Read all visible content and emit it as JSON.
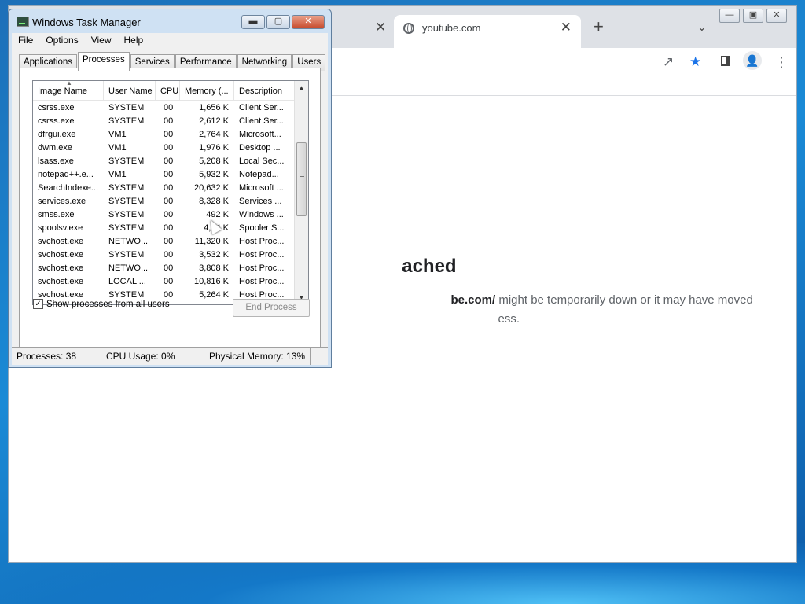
{
  "browser": {
    "active_tab_title": "youtube.com",
    "new_tab_symbol": "+",
    "close_symbol": "✕",
    "error": {
      "title_partial": "ached",
      "url_partial": "be.com/",
      "line1_rest": " might be temporarily down or it may have moved",
      "line2_partial": "ess."
    }
  },
  "task_manager": {
    "title": "Windows Task Manager",
    "menu": [
      "File",
      "Options",
      "View",
      "Help"
    ],
    "tabs": [
      "Applications",
      "Processes",
      "Services",
      "Performance",
      "Networking",
      "Users"
    ],
    "active_tab": "Processes",
    "columns": {
      "name": "Image Name",
      "user": "User Name",
      "cpu": "CPU",
      "memory": "Memory (...",
      "description": "Description"
    },
    "processes": [
      {
        "name": "csrss.exe",
        "user": "SYSTEM",
        "cpu": "00",
        "memory": "1,656 K",
        "description": "Client Ser..."
      },
      {
        "name": "csrss.exe",
        "user": "SYSTEM",
        "cpu": "00",
        "memory": "2,612 K",
        "description": "Client Ser..."
      },
      {
        "name": "dfrgui.exe",
        "user": "VM1",
        "cpu": "00",
        "memory": "2,764 K",
        "description": "Microsoft..."
      },
      {
        "name": "dwm.exe",
        "user": "VM1",
        "cpu": "00",
        "memory": "1,976 K",
        "description": "Desktop ..."
      },
      {
        "name": "lsass.exe",
        "user": "SYSTEM",
        "cpu": "00",
        "memory": "5,208 K",
        "description": "Local Sec..."
      },
      {
        "name": "notepad++.e...",
        "user": "VM1",
        "cpu": "00",
        "memory": "5,932 K",
        "description": "Notepad..."
      },
      {
        "name": "SearchIndexe...",
        "user": "SYSTEM",
        "cpu": "00",
        "memory": "20,632 K",
        "description": "Microsoft ..."
      },
      {
        "name": "services.exe",
        "user": "SYSTEM",
        "cpu": "00",
        "memory": "8,328 K",
        "description": "Services ..."
      },
      {
        "name": "smss.exe",
        "user": "SYSTEM",
        "cpu": "00",
        "memory": "492 K",
        "description": "Windows ..."
      },
      {
        "name": "spoolsv.exe",
        "user": "SYSTEM",
        "cpu": "00",
        "memory": "4,?4 K",
        "description": "Spooler S..."
      },
      {
        "name": "svchost.exe",
        "user": "NETWO...",
        "cpu": "00",
        "memory": "11,320 K",
        "description": "Host Proc..."
      },
      {
        "name": "svchost.exe",
        "user": "SYSTEM",
        "cpu": "00",
        "memory": "3,532 K",
        "description": "Host Proc..."
      },
      {
        "name": "svchost.exe",
        "user": "NETWO...",
        "cpu": "00",
        "memory": "3,808 K",
        "description": "Host Proc..."
      },
      {
        "name": "svchost.exe",
        "user": "LOCAL ...",
        "cpu": "00",
        "memory": "10,816 K",
        "description": "Host Proc..."
      },
      {
        "name": "svchost.exe",
        "user": "SYSTEM",
        "cpu": "00",
        "memory": "5,264 K",
        "description": "Host Proc..."
      }
    ],
    "show_all_label": "Show processes from all users",
    "show_all_checked": true,
    "end_process_label": "End Process",
    "status": {
      "processes": "Processes: 38",
      "cpu_usage": "CPU Usage: 0%",
      "physical_memory": "Physical Memory: 13%"
    }
  }
}
